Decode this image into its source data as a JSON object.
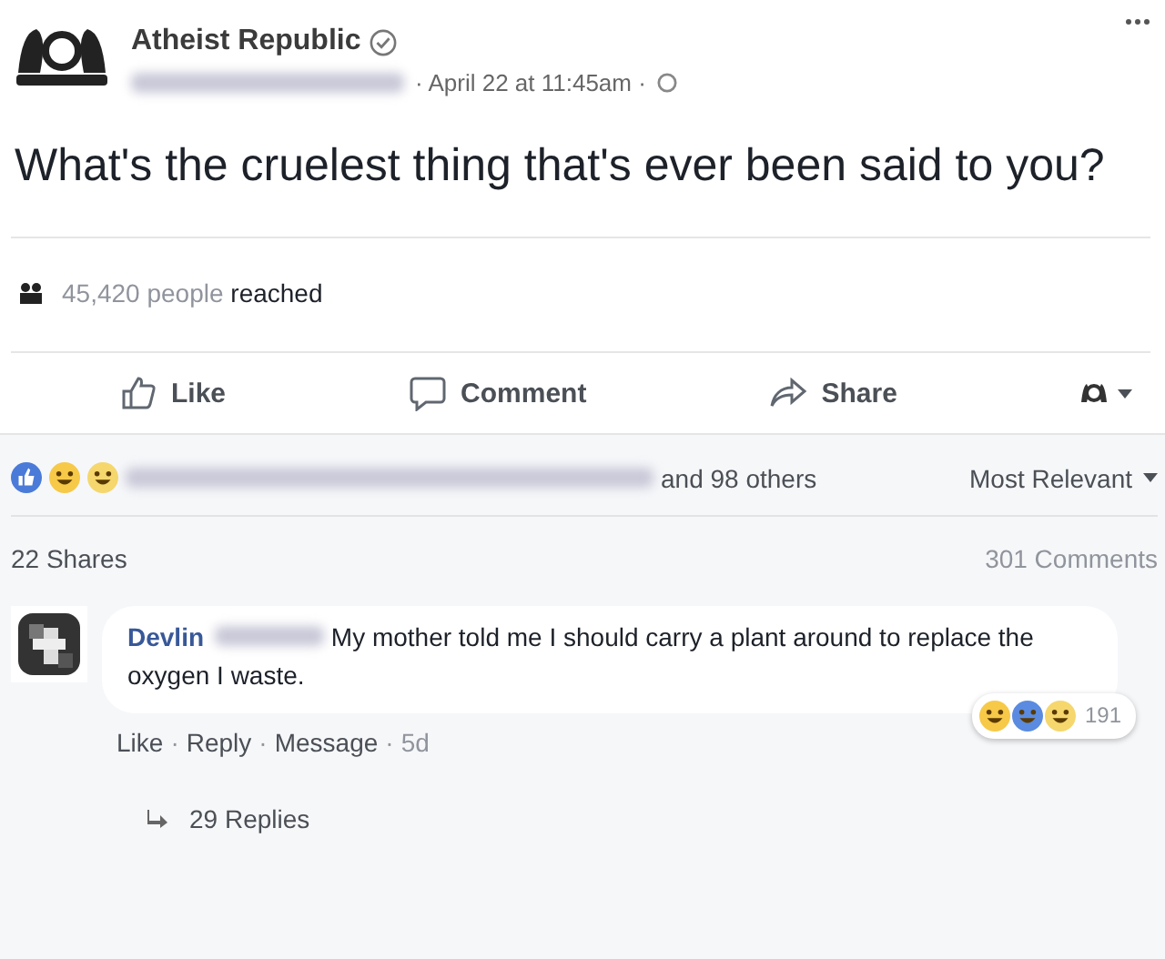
{
  "post": {
    "page_name": "Atheist Republic",
    "verified": true,
    "timestamp": "· April 22 at 11:45am ·",
    "text": "What's the cruelest thing that's ever been said to you?",
    "reach": {
      "count": "45,420 people",
      "label": "reached"
    }
  },
  "actions": [
    {
      "kind": "like",
      "label": "Like"
    },
    {
      "kind": "comment",
      "label": "Comment"
    },
    {
      "kind": "share",
      "label": "Share"
    }
  ],
  "reactions": {
    "others": "and 98 others",
    "sort": "Most Relevant"
  },
  "counts": {
    "shares": "22 Shares",
    "comments": "301 Comments"
  },
  "comment": {
    "author": "Devlin",
    "text": "My mother told me I should carry a plant around to replace the oxygen I waste.",
    "links": [
      "Like",
      "Reply",
      "Message"
    ],
    "age": "5d",
    "separator": "·",
    "reaction_count": "191",
    "replies": "29 Replies"
  }
}
